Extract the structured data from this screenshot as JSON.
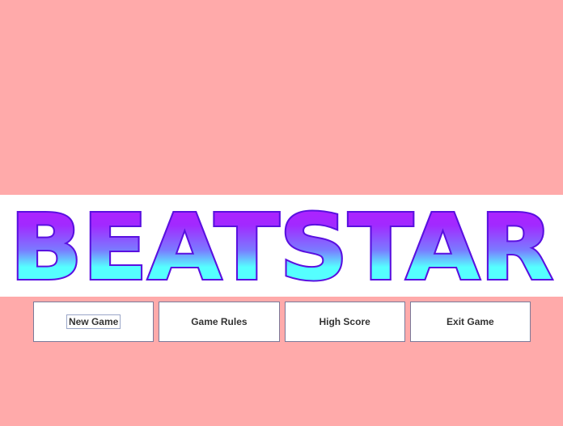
{
  "title": "BEATSTAR",
  "menu": {
    "buttons": [
      {
        "label": "New Game",
        "focused": true
      },
      {
        "label": "Game Rules",
        "focused": false
      },
      {
        "label": "High Score",
        "focused": false
      },
      {
        "label": "Exit Game",
        "focused": false
      }
    ]
  },
  "colors": {
    "background": "#ffaaaa",
    "banner_background": "#ffffff",
    "title_gradient_top": "#b81cff",
    "title_gradient_bottom": "#55ffff",
    "title_outline": "#5a10e0"
  }
}
